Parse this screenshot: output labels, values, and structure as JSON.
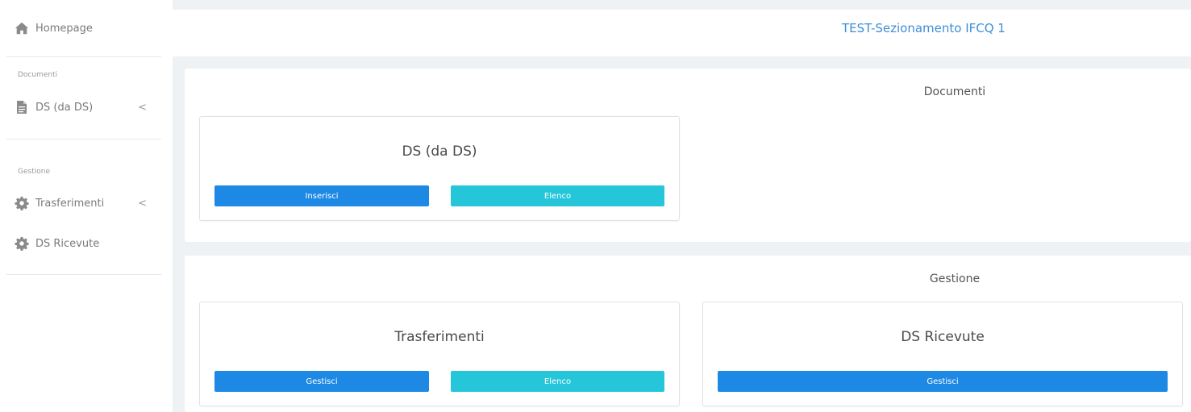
{
  "sidebar": {
    "homepage_label": "Homepage",
    "sections": [
      {
        "title": "Documenti",
        "items": [
          {
            "label": "DS (da DS)",
            "icon": "file-icon",
            "has_chevron": true
          }
        ]
      },
      {
        "title": "Gestione",
        "items": [
          {
            "label": "Trasferimenti",
            "icon": "gear-icon",
            "has_chevron": true
          },
          {
            "label": "DS Ricevute",
            "icon": "gear-icon",
            "has_chevron": false
          }
        ]
      }
    ],
    "chevron_glyph": "<"
  },
  "header": {
    "title": "TEST-Sezionamento IFCQ 1"
  },
  "panels": [
    {
      "title": "Documenti",
      "cards": [
        {
          "title": "DS (da DS)",
          "buttons": [
            {
              "label": "Inserisci",
              "style": "blue"
            },
            {
              "label": "Elenco",
              "style": "cyan"
            }
          ]
        }
      ]
    },
    {
      "title": "Gestione",
      "cards": [
        {
          "title": "Trasferimenti",
          "buttons": [
            {
              "label": "Gestisci",
              "style": "blue"
            },
            {
              "label": "Elenco",
              "style": "cyan"
            }
          ]
        },
        {
          "title": "DS Ricevute",
          "buttons": [
            {
              "label": "Gestisci",
              "style": "blue"
            }
          ]
        }
      ]
    }
  ],
  "colors": {
    "accent_blue": "#1e88e5",
    "accent_cyan": "#26c6da",
    "title_blue": "#3d8fd7",
    "background": "#eef2f4"
  }
}
